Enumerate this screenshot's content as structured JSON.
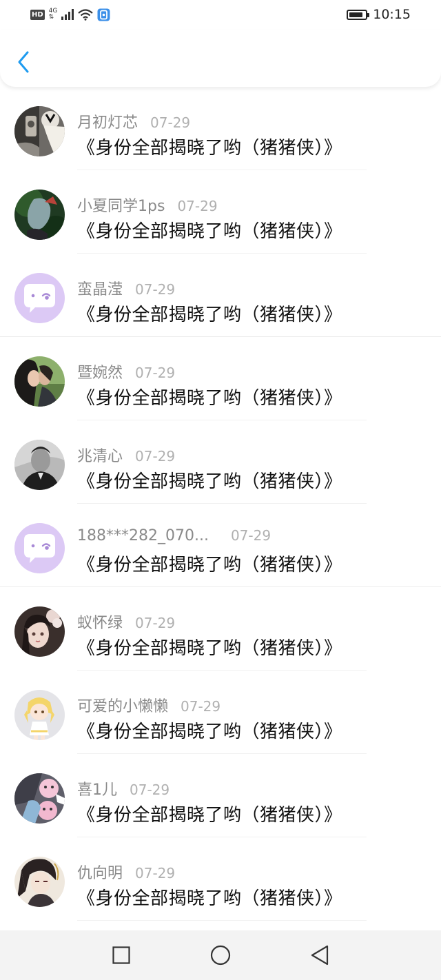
{
  "status_bar": {
    "hd_label": "HD",
    "network_label": "4G",
    "network_sub": "⇅",
    "time": "10:15",
    "battery_level": 0.85
  },
  "header": {
    "back_icon": "chevron-left-icon"
  },
  "colors": {
    "accent": "#1e9bf0",
    "placeholder_avatar": "#dcc9f5"
  },
  "comments": [
    {
      "nick": "月初灯芯",
      "date": "07-29",
      "text": "《身份全部揭晓了哟（猪猪侠）》",
      "avatar": "photo-dark"
    },
    {
      "nick": "小夏同学1ps",
      "date": "07-29",
      "text": "《身份全部揭晓了哟（猪猪侠）》",
      "avatar": "photo-green"
    },
    {
      "nick": "蛮晶滢",
      "date": "07-29",
      "text": "《身份全部揭晓了哟（猪猪侠）》",
      "avatar": "default"
    },
    {
      "nick": "暨婉然",
      "date": "07-29",
      "text": "《身份全部揭晓了哟（猪猪侠）》",
      "avatar": "photo-couple"
    },
    {
      "nick": "兆清心",
      "date": "07-29",
      "text": "《身份全部揭晓了哟（猪猪侠）》",
      "avatar": "photo-bw"
    },
    {
      "nick": "188***282_070...",
      "date": "07-29",
      "text": "《身份全部揭晓了哟（猪猪侠）》",
      "avatar": "default"
    },
    {
      "nick": "蚁怀绿",
      "date": "07-29",
      "text": "《身份全部揭晓了哟（猪猪侠）》",
      "avatar": "photo-doll"
    },
    {
      "nick": "可爱的小懒懒",
      "date": "07-29",
      "text": "《身份全部揭晓了哟（猪猪侠）》",
      "avatar": "photo-cartoon"
    },
    {
      "nick": "喜1儿",
      "date": "07-29",
      "text": "《身份全部揭晓了哟（猪猪侠）》",
      "avatar": "photo-pink"
    },
    {
      "nick": "仇向明",
      "date": "07-29",
      "text": "《身份全部揭晓了哟（猪猪侠）》",
      "avatar": "photo-anime"
    }
  ],
  "nav_bar": {
    "recent_icon": "square-icon",
    "home_icon": "circle-icon",
    "back_icon": "triangle-back-icon"
  }
}
